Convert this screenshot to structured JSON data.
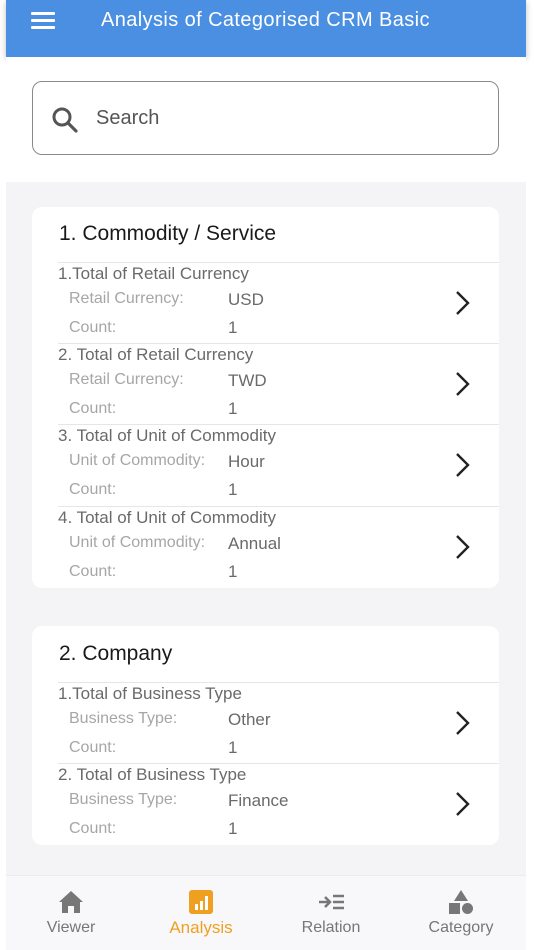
{
  "header": {
    "title": "Analysis of Categorised CRM Basic"
  },
  "search": {
    "placeholder": "Search"
  },
  "sections": [
    {
      "title": "1. Commodity / Service",
      "rows": [
        {
          "heading": "1.Total of Retail Currency",
          "key": "Retail Currency:",
          "value": "USD",
          "count_label": "Count:",
          "count": "1"
        },
        {
          "heading": "2. Total of Retail Currency",
          "key": "Retail Currency:",
          "value": "TWD",
          "count_label": "Count:",
          "count": "1"
        },
        {
          "heading": "3. Total of Unit of Commodity",
          "key": "Unit of Commodity:",
          "value": "Hour",
          "count_label": "Count:",
          "count": "1"
        },
        {
          "heading": "4. Total of Unit of Commodity",
          "key": "Unit of Commodity:",
          "value": "Annual",
          "count_label": "Count:",
          "count": "1"
        }
      ]
    },
    {
      "title": "2. Company",
      "rows": [
        {
          "heading": "1.Total of Business Type",
          "key": "Business Type:",
          "value": "Other",
          "count_label": "Count:",
          "count": "1"
        },
        {
          "heading": "2. Total of Business Type",
          "key": "Business Type:",
          "value": "Finance",
          "count_label": "Count:",
          "count": "1"
        }
      ]
    }
  ],
  "tabs": [
    {
      "label": "Viewer",
      "icon": "home-icon",
      "active": false
    },
    {
      "label": "Analysis",
      "icon": "bar-chart-icon",
      "active": true
    },
    {
      "label": "Relation",
      "icon": "relation-icon",
      "active": false
    },
    {
      "label": "Category",
      "icon": "shapes-icon",
      "active": false
    }
  ],
  "colors": {
    "header": "#4a8fe2",
    "active_tab": "#f0a020",
    "inactive_tab": "#777777"
  }
}
